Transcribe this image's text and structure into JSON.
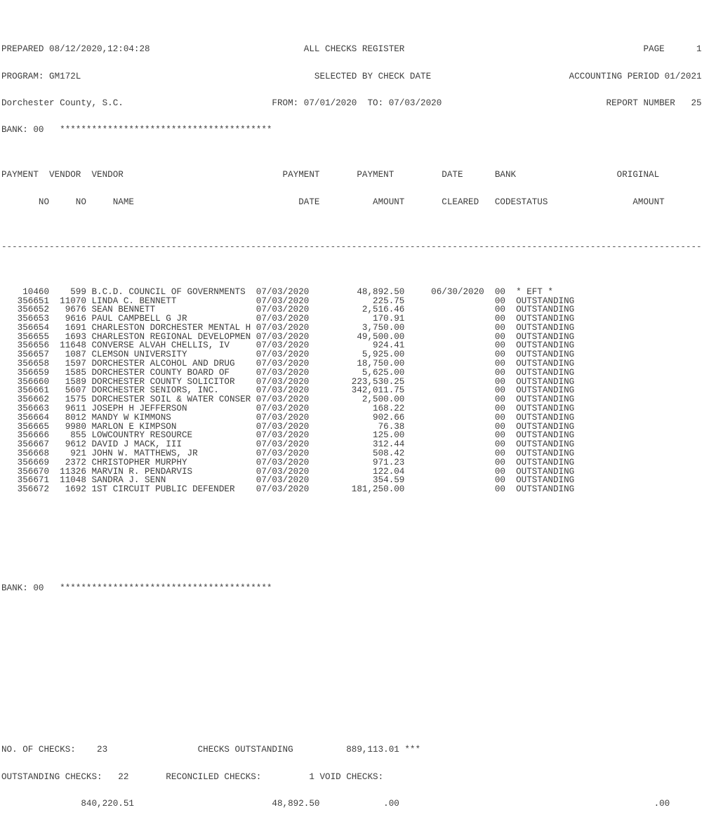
{
  "report": {
    "prepared_label": "PREPARED",
    "prepared_datetime": "08/12/2020,12:04:28",
    "program_label": "PROGRAM:",
    "program_name": "GM172L",
    "entity": "Dorchester County, S.C.",
    "bank_label": "BANK:",
    "bank_code": "00",
    "title": "ALL CHECKS REGISTER",
    "subtitle": "SELECTED BY CHECK DATE",
    "from_label": "FROM:",
    "from_date": "07/01/2020",
    "to_label": "TO:",
    "to_date": "07/03/2020",
    "page_label": "PAGE",
    "page_number": "1",
    "accounting_period_label": "ACCOUNTING PERIOD",
    "accounting_period": "01/2021",
    "report_number_label": "REPORT NUMBER",
    "report_number": "25",
    "separator_char": "-",
    "star_char": "*",
    "bank_star_count": 40
  },
  "columns": {
    "payment_no": [
      "PAYMENT",
      "NO"
    ],
    "vendor_no": [
      "VENDOR",
      "NO"
    ],
    "vendor_name": [
      "VENDOR",
      "NAME"
    ],
    "payment_date": [
      "PAYMENT",
      "DATE"
    ],
    "payment_amount": [
      "PAYMENT",
      "AMOUNT"
    ],
    "date_cleared": [
      "DATE",
      "CLEARED"
    ],
    "bank_code": [
      "BANK",
      "CODE"
    ],
    "status": [
      "",
      "STATUS"
    ],
    "original_amount": [
      "ORIGINAL",
      "AMOUNT"
    ]
  },
  "rows": [
    {
      "payment_no": "10460",
      "vendor_no": "599",
      "vendor_name": "B.C.D. COUNCIL OF GOVERNMENTS",
      "payment_date": "07/03/2020",
      "payment_amount": "48,892.50",
      "date_cleared": "06/30/2020",
      "bank_code": "00",
      "status": "* EFT *",
      "original_amount": ""
    },
    {
      "payment_no": "356651",
      "vendor_no": "11070",
      "vendor_name": "LINDA C. BENNETT",
      "payment_date": "07/03/2020",
      "payment_amount": "225.75",
      "date_cleared": "",
      "bank_code": "00",
      "status": "OUTSTANDING",
      "original_amount": ""
    },
    {
      "payment_no": "356652",
      "vendor_no": "9676",
      "vendor_name": "SEAN BENNETT",
      "payment_date": "07/03/2020",
      "payment_amount": "2,516.46",
      "date_cleared": "",
      "bank_code": "00",
      "status": "OUTSTANDING",
      "original_amount": ""
    },
    {
      "payment_no": "356653",
      "vendor_no": "9616",
      "vendor_name": "PAUL CAMPBELL G JR",
      "payment_date": "07/03/2020",
      "payment_amount": "170.91",
      "date_cleared": "",
      "bank_code": "00",
      "status": "OUTSTANDING",
      "original_amount": ""
    },
    {
      "payment_no": "356654",
      "vendor_no": "1691",
      "vendor_name": "CHARLESTON DORCHESTER MENTAL H",
      "payment_date": "07/03/2020",
      "payment_amount": "3,750.00",
      "date_cleared": "",
      "bank_code": "00",
      "status": "OUTSTANDING",
      "original_amount": ""
    },
    {
      "payment_no": "356655",
      "vendor_no": "1693",
      "vendor_name": "CHARLESTON REGIONAL DEVELOPMEN",
      "payment_date": "07/03/2020",
      "payment_amount": "49,500.00",
      "date_cleared": "",
      "bank_code": "00",
      "status": "OUTSTANDING",
      "original_amount": ""
    },
    {
      "payment_no": "356656",
      "vendor_no": "11648",
      "vendor_name": "CONVERSE ALVAH CHELLIS, IV",
      "payment_date": "07/03/2020",
      "payment_amount": "924.41",
      "date_cleared": "",
      "bank_code": "00",
      "status": "OUTSTANDING",
      "original_amount": ""
    },
    {
      "payment_no": "356657",
      "vendor_no": "1087",
      "vendor_name": "CLEMSON UNIVERSITY",
      "payment_date": "07/03/2020",
      "payment_amount": "5,925.00",
      "date_cleared": "",
      "bank_code": "00",
      "status": "OUTSTANDING",
      "original_amount": ""
    },
    {
      "payment_no": "356658",
      "vendor_no": "1597",
      "vendor_name": "DORCHESTER ALCOHOL AND DRUG",
      "payment_date": "07/03/2020",
      "payment_amount": "18,750.00",
      "date_cleared": "",
      "bank_code": "00",
      "status": "OUTSTANDING",
      "original_amount": ""
    },
    {
      "payment_no": "356659",
      "vendor_no": "1585",
      "vendor_name": "DORCHESTER COUNTY BOARD OF",
      "payment_date": "07/03/2020",
      "payment_amount": "5,625.00",
      "date_cleared": "",
      "bank_code": "00",
      "status": "OUTSTANDING",
      "original_amount": ""
    },
    {
      "payment_no": "356660",
      "vendor_no": "1589",
      "vendor_name": "DORCHESTER COUNTY SOLICITOR",
      "payment_date": "07/03/2020",
      "payment_amount": "223,530.25",
      "date_cleared": "",
      "bank_code": "00",
      "status": "OUTSTANDING",
      "original_amount": ""
    },
    {
      "payment_no": "356661",
      "vendor_no": "5607",
      "vendor_name": "DORCHESTER SENIORS, INC.",
      "payment_date": "07/03/2020",
      "payment_amount": "342,011.75",
      "date_cleared": "",
      "bank_code": "00",
      "status": "OUTSTANDING",
      "original_amount": ""
    },
    {
      "payment_no": "356662",
      "vendor_no": "1575",
      "vendor_name": "DORCHESTER SOIL & WATER CONSER",
      "payment_date": "07/03/2020",
      "payment_amount": "2,500.00",
      "date_cleared": "",
      "bank_code": "00",
      "status": "OUTSTANDING",
      "original_amount": ""
    },
    {
      "payment_no": "356663",
      "vendor_no": "9611",
      "vendor_name": "JOSEPH H JEFFERSON",
      "payment_date": "07/03/2020",
      "payment_amount": "168.22",
      "date_cleared": "",
      "bank_code": "00",
      "status": "OUTSTANDING",
      "original_amount": ""
    },
    {
      "payment_no": "356664",
      "vendor_no": "8012",
      "vendor_name": "MANDY W KIMMONS",
      "payment_date": "07/03/2020",
      "payment_amount": "902.66",
      "date_cleared": "",
      "bank_code": "00",
      "status": "OUTSTANDING",
      "original_amount": ""
    },
    {
      "payment_no": "356665",
      "vendor_no": "9980",
      "vendor_name": "MARLON E KIMPSON",
      "payment_date": "07/03/2020",
      "payment_amount": "76.38",
      "date_cleared": "",
      "bank_code": "00",
      "status": "OUTSTANDING",
      "original_amount": ""
    },
    {
      "payment_no": "356666",
      "vendor_no": "855",
      "vendor_name": "LOWCOUNTRY RESOURCE",
      "payment_date": "07/03/2020",
      "payment_amount": "125.00",
      "date_cleared": "",
      "bank_code": "00",
      "status": "OUTSTANDING",
      "original_amount": ""
    },
    {
      "payment_no": "356667",
      "vendor_no": "9612",
      "vendor_name": "DAVID J MACK, III",
      "payment_date": "07/03/2020",
      "payment_amount": "312.44",
      "date_cleared": "",
      "bank_code": "00",
      "status": "OUTSTANDING",
      "original_amount": ""
    },
    {
      "payment_no": "356668",
      "vendor_no": "921",
      "vendor_name": "JOHN W. MATTHEWS, JR",
      "payment_date": "07/03/2020",
      "payment_amount": "508.42",
      "date_cleared": "",
      "bank_code": "00",
      "status": "OUTSTANDING",
      "original_amount": ""
    },
    {
      "payment_no": "356669",
      "vendor_no": "2372",
      "vendor_name": "CHRISTOPHER MURPHY",
      "payment_date": "07/03/2020",
      "payment_amount": "971.23",
      "date_cleared": "",
      "bank_code": "00",
      "status": "OUTSTANDING",
      "original_amount": ""
    },
    {
      "payment_no": "356670",
      "vendor_no": "11326",
      "vendor_name": "MARVIN R. PENDARVIS",
      "payment_date": "07/03/2020",
      "payment_amount": "122.04",
      "date_cleared": "",
      "bank_code": "00",
      "status": "OUTSTANDING",
      "original_amount": ""
    },
    {
      "payment_no": "356671",
      "vendor_no": "11048",
      "vendor_name": "SANDRA J. SENN",
      "payment_date": "07/03/2020",
      "payment_amount": "354.59",
      "date_cleared": "",
      "bank_code": "00",
      "status": "OUTSTANDING",
      "original_amount": ""
    },
    {
      "payment_no": "356672",
      "vendor_no": "1692",
      "vendor_name": "1ST CIRCUIT PUBLIC DEFENDER",
      "payment_date": "07/03/2020",
      "payment_amount": "181,250.00",
      "date_cleared": "",
      "bank_code": "00",
      "status": "OUTSTANDING",
      "original_amount": ""
    }
  ],
  "totals": {
    "bank_footer_label": "BANK:",
    "bank_footer_code": "00",
    "no_of_checks_label": "NO. OF CHECKS:",
    "no_of_checks": "23",
    "checks_outstanding_label": "CHECKS OUTSTANDING",
    "checks_outstanding_amount": "889,113.01",
    "checks_outstanding_flag": "***",
    "outstanding_checks_label": "OUTSTANDING CHECKS:",
    "outstanding_checks_count": "22",
    "outstanding_checks_amount": "840,220.51",
    "reconciled_checks_label": "RECONCILED CHECKS:",
    "reconciled_checks_count": "1",
    "reconciled_checks_amount": "48,892.50",
    "void_checks_label": "VOID CHECKS:",
    "void_checks_amount": ".00",
    "original_total_amount": ".00"
  }
}
